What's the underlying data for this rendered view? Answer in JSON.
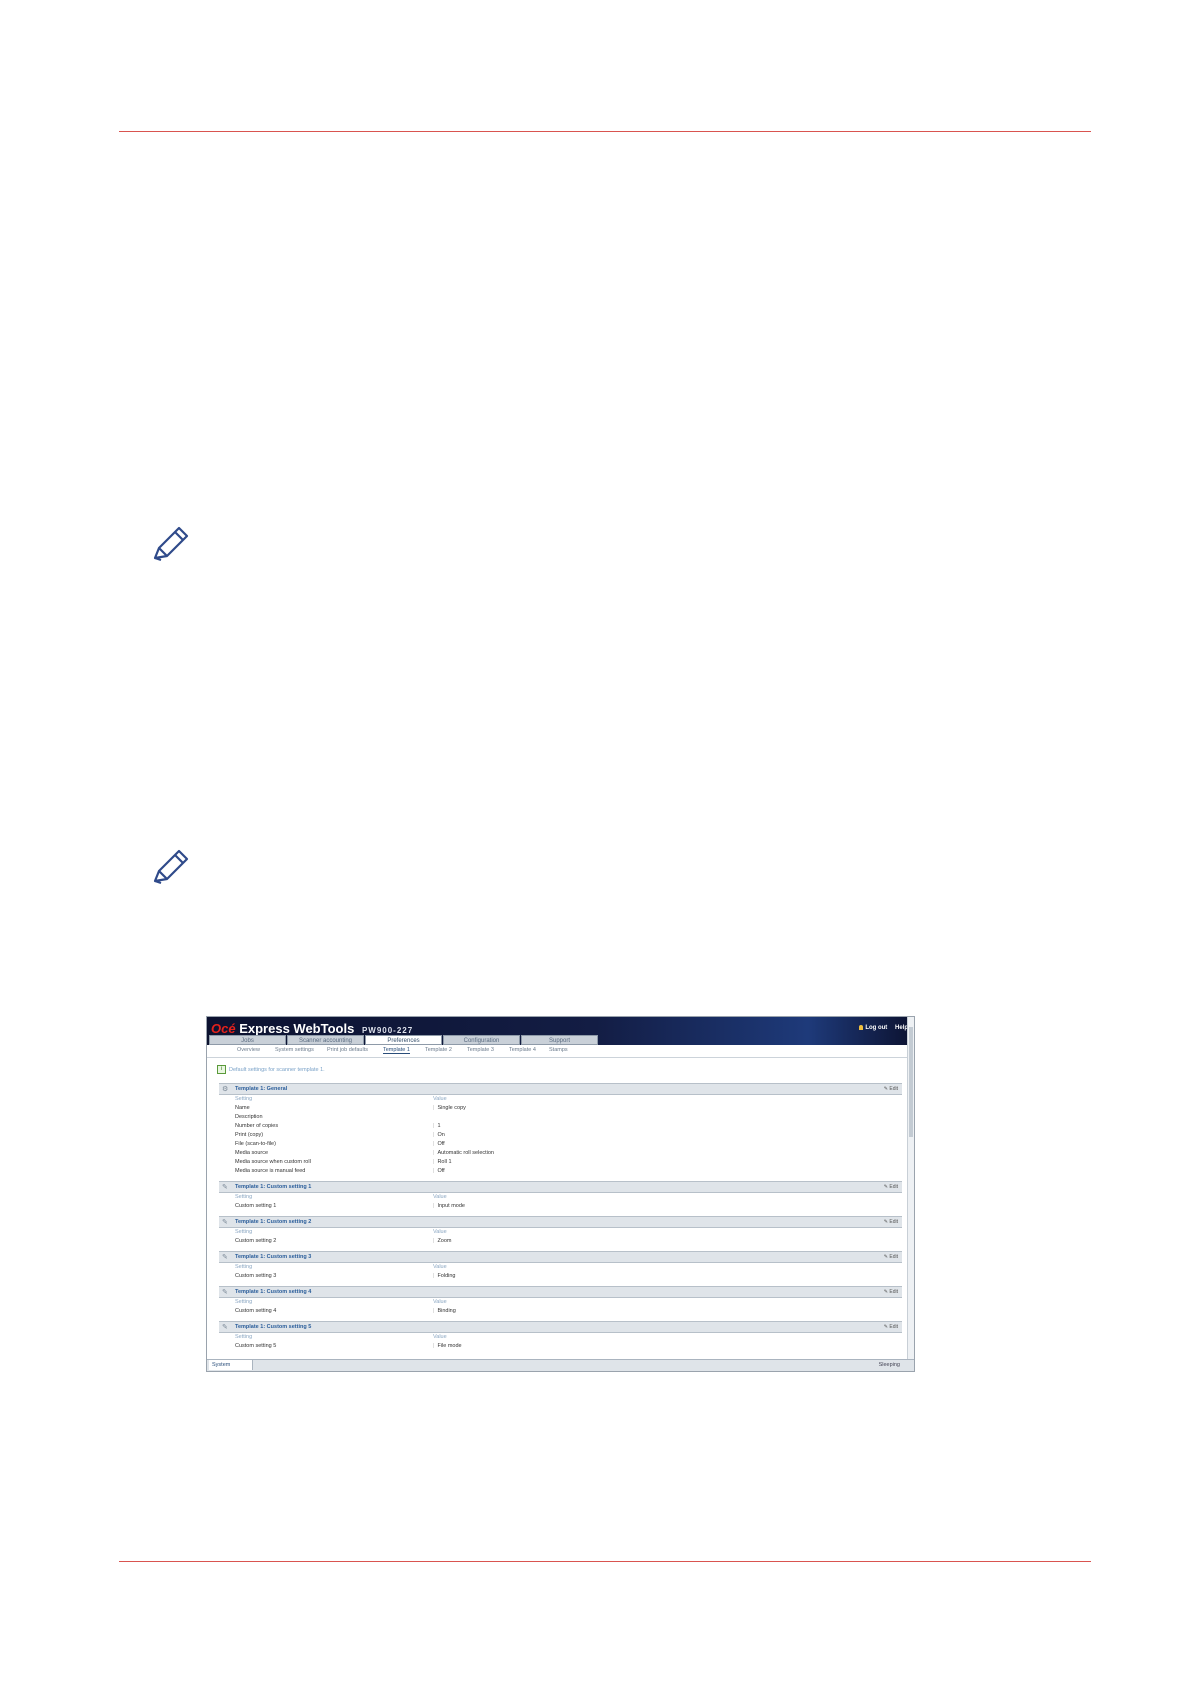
{
  "app": {
    "brand": "Océ",
    "product": "Express WebTools",
    "model": "PW900-227",
    "links": [
      "Log out",
      "Help"
    ]
  },
  "main_tabs": [
    "Jobs",
    "Scanner accounting",
    "Preferences",
    "Configuration",
    "Support"
  ],
  "sub_tabs": [
    "Overview",
    "System settings",
    "Print job defaults",
    "Template 1",
    "Template 2",
    "Template 3",
    "Template 4",
    "Stamps"
  ],
  "info_text": "Default settings for scanner template 1.",
  "edit_label": "Edit",
  "col_setting": "Setting",
  "col_value": "Value",
  "panels": [
    {
      "title": "Template 1: General",
      "rows": [
        [
          "Name",
          "Single copy"
        ],
        [
          "Description",
          ""
        ],
        [
          "Number of copies",
          "1"
        ],
        [
          "Print (copy)",
          "On"
        ],
        [
          "File (scan-to-file)",
          "Off"
        ],
        [
          "Media source",
          "Automatic roll selection"
        ],
        [
          "Media source when custom roll",
          "Roll 1"
        ],
        [
          "Media source is manual feed",
          "Off"
        ]
      ]
    },
    {
      "title": "Template 1: Custom setting 1",
      "rows": [
        [
          "Custom setting 1",
          "Input mode"
        ]
      ]
    },
    {
      "title": "Template 1: Custom setting 2",
      "rows": [
        [
          "Custom setting 2",
          "Zoom"
        ]
      ]
    },
    {
      "title": "Template 1: Custom setting 3",
      "rows": [
        [
          "Custom setting 3",
          "Folding"
        ]
      ]
    },
    {
      "title": "Template 1: Custom setting 4",
      "rows": [
        [
          "Custom setting 4",
          "Binding"
        ]
      ]
    },
    {
      "title": "Template 1: Custom setting 5",
      "rows": [
        [
          "Custom setting 5",
          "File mode"
        ]
      ]
    }
  ],
  "status": {
    "tab": "System",
    "right": "Sleeping"
  }
}
